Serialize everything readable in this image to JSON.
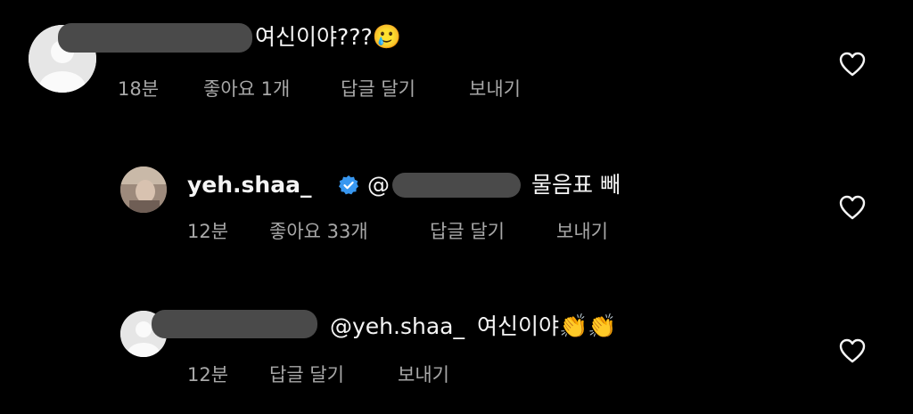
{
  "comments": [
    {
      "text": "여신이야???",
      "emoji": "🥲",
      "time": "18분",
      "likes": "좋아요 1개",
      "reply": "답글 달기",
      "send": "보내기"
    },
    {
      "username": "yeh.shaa_",
      "mention_prefix": "@",
      "text": "물음표 빼",
      "time": "12분",
      "likes": "좋아요 33개",
      "reply": "답글 달기",
      "send": "보내기"
    },
    {
      "mention": "@yeh.shaa_",
      "text": "여신이야",
      "emoji": "👏👏",
      "time": "12분",
      "reply": "답글 달기",
      "send": "보내기"
    }
  ],
  "icons": {
    "heart": "heart-outline-icon",
    "verified": "verified-badge-icon",
    "avatar": "default-avatar-icon"
  },
  "colors": {
    "background": "#000000",
    "text": "#f5f5f5",
    "meta": "#a8a8a8",
    "verified": "#3897f0"
  }
}
